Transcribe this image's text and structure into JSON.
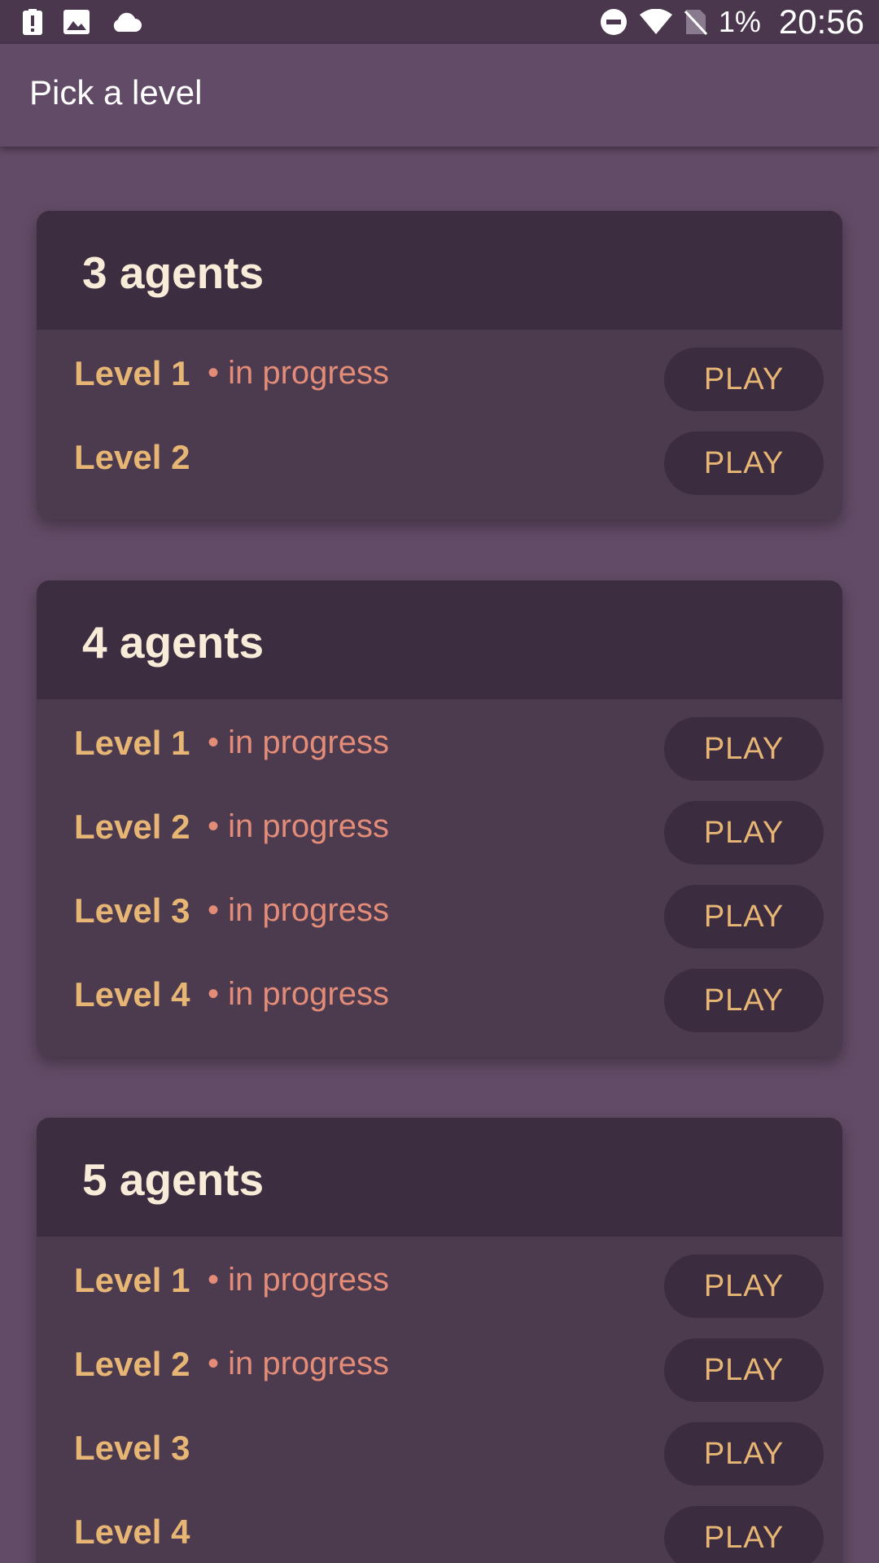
{
  "status_bar": {
    "icons_left": [
      "alert-icon",
      "image-icon",
      "cloud-icon"
    ],
    "icons_right": [
      "do-not-disturb-icon",
      "wifi-icon",
      "no-sim-icon"
    ],
    "battery": "1%",
    "time": "20:56"
  },
  "app_bar": {
    "title": "Pick a level"
  },
  "colors": {
    "background": "#624b66",
    "status_bar": "#4a374e",
    "card": "#4c3a4f",
    "card_header": "#3d2d40",
    "title_text": "#f8ecd8",
    "level_text": "#e7b675",
    "status_text": "#e38c78",
    "button_bg": "#3c2c3f"
  },
  "groups": [
    {
      "title": "3 agents",
      "levels": [
        {
          "name": "Level 1",
          "status": "• in progress",
          "button": "PLAY"
        },
        {
          "name": "Level 2",
          "status": "",
          "button": "PLAY"
        }
      ]
    },
    {
      "title": "4 agents",
      "levels": [
        {
          "name": "Level 1",
          "status": "• in progress",
          "button": "PLAY"
        },
        {
          "name": "Level 2",
          "status": "• in progress",
          "button": "PLAY"
        },
        {
          "name": "Level 3",
          "status": "• in progress",
          "button": "PLAY"
        },
        {
          "name": "Level 4",
          "status": "• in progress",
          "button": "PLAY"
        }
      ]
    },
    {
      "title": "5 agents",
      "levels": [
        {
          "name": "Level 1",
          "status": "• in progress",
          "button": "PLAY"
        },
        {
          "name": "Level 2",
          "status": "• in progress",
          "button": "PLAY"
        },
        {
          "name": "Level 3",
          "status": "",
          "button": "PLAY"
        },
        {
          "name": "Level 4",
          "status": "",
          "button": "PLAY"
        }
      ]
    }
  ]
}
